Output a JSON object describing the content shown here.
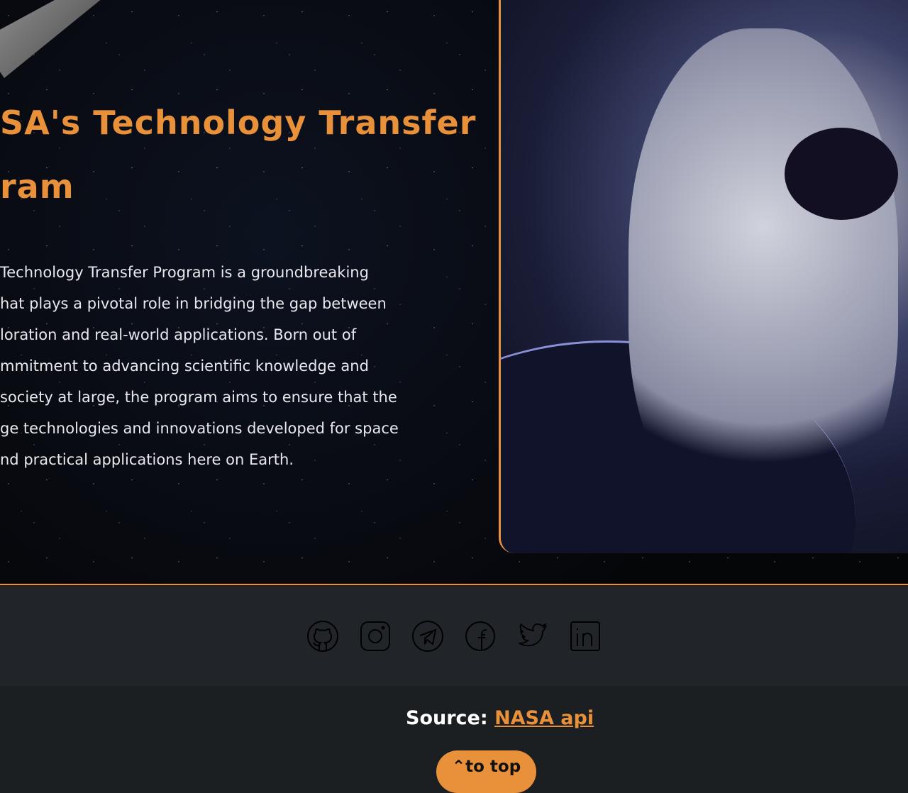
{
  "hero": {
    "title_lines": [
      "SA's Technology Transfer",
      "ram"
    ],
    "paragraph_lines": [
      " Technology Transfer Program is a groundbreaking",
      "hat plays a pivotal role in bridging the gap between",
      "loration and real-world applications. Born out of",
      "mmitment to advancing scientific knowledge and",
      "society at large, the program aims to ensure that the",
      "ge technologies and innovations developed for space",
      "nd practical applications here on Earth."
    ]
  },
  "social": [
    "github-icon",
    "instagram-icon",
    "telegram-icon",
    "facebook-icon",
    "twitter-icon",
    "linkedin-icon"
  ],
  "footer": {
    "source_label": "Source:",
    "source_link": "NASA api",
    "to_top": "to top"
  },
  "colors": {
    "accent": "#e8913a"
  }
}
